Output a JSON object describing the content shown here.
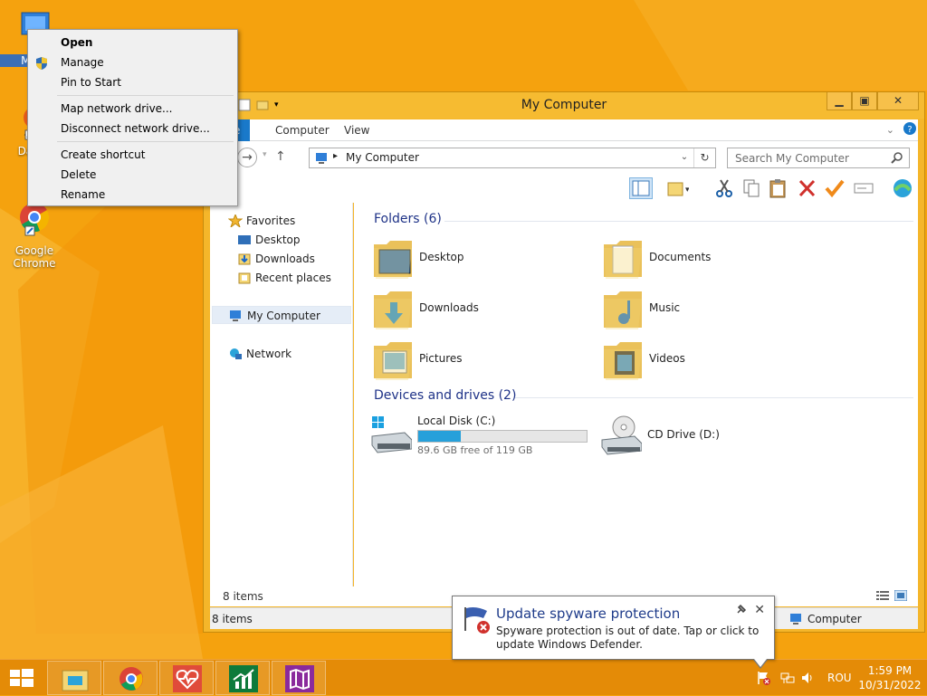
{
  "desktop": {
    "icons": [
      {
        "label": "My C"
      },
      {
        "label": "DataV"
      },
      {
        "label": "Google Chrome"
      }
    ]
  },
  "context_menu": {
    "items": [
      "Open",
      "Manage",
      "Pin to Start",
      "Map network drive...",
      "Disconnect network drive...",
      "Create shortcut",
      "Delete",
      "Rename"
    ]
  },
  "window": {
    "title": "My Computer",
    "tabs": [
      "e",
      "Computer",
      "View"
    ],
    "address": "My Computer",
    "search_placeholder": "Search My Computer",
    "nav": {
      "favorites": "Favorites",
      "desktop": "Desktop",
      "downloads": "Downloads",
      "recent": "Recent places",
      "computer": "My Computer",
      "network": "Network"
    },
    "folders_header": "Folders (6)",
    "folders": [
      "Desktop",
      "Documents",
      "Downloads",
      "Music",
      "Pictures",
      "Videos"
    ],
    "drives_header": "Devices and drives (2)",
    "drives": {
      "c_name": "Local Disk (C:)",
      "c_free": "89.6 GB free of 119 GB",
      "c_used_fraction": 0.25,
      "d_name": "CD Drive (D:)"
    },
    "status_count": "8 items",
    "details_count": "8 items",
    "details_zone": "Computer"
  },
  "balloon": {
    "title": "Update spyware protection",
    "body": "Spyware protection is out of date. Tap or click to update Windows Defender."
  },
  "taskbar": {
    "language": "ROU",
    "time": "1:59 PM",
    "date": "10/31/2022"
  },
  "colors": {
    "accent": "#1979ca",
    "wallpaper": "#f5a20e",
    "taskbar": "#e48b07",
    "header_text": "#1e3287"
  }
}
